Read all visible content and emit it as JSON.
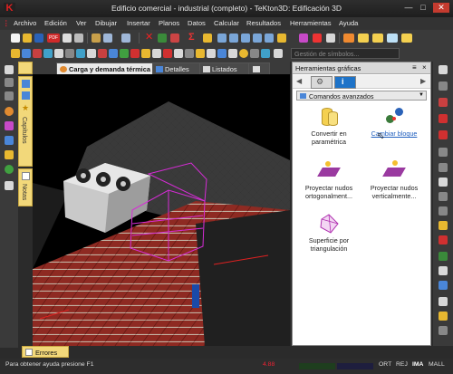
{
  "window": {
    "title": "Edificio comercial - industrial (completo) - TeKton3D: Edificación 3D",
    "app_icon_letter": "K"
  },
  "menu": [
    "Archivo",
    "Edición",
    "Ver",
    "Dibujar",
    "Insertar",
    "Planos",
    "Datos",
    "Calcular",
    "Resultados",
    "Herramientas",
    "Ayuda"
  ],
  "symbol_search": {
    "placeholder": "Gestión de símbolos..."
  },
  "left_tabs": {
    "chapters": "Capítulos",
    "notes": "Notas"
  },
  "view_tabs": [
    "Carga y demanda térmica",
    "Detalles",
    "Listados"
  ],
  "panel": {
    "title": "Herramientas gráficas",
    "combo": "Comandos avanzados",
    "commands": [
      {
        "label": "Convertir en paramétrica",
        "icon": "convert-parametric-icon"
      },
      {
        "label": "Cambiar bloque",
        "icon": "change-block-icon"
      },
      {
        "label": "Proyectar nudos ortogonalment...",
        "icon": "project-nodes-orthogonal-icon"
      },
      {
        "label": "Proyectar nudos verticalmente...",
        "icon": "project-nodes-vertical-icon"
      },
      {
        "label": "Superficie por triangulación",
        "icon": "triangulation-surface-icon"
      }
    ]
  },
  "errors_tab": "Errores",
  "status": {
    "help": "Para obtener ayuda presione F1",
    "indicators": [
      "ORT",
      "REJ",
      "IMA",
      "MALL"
    ],
    "coord_x": "4.88"
  },
  "colors": {
    "accent": "#1e73c8",
    "tab_yellow": "#f2d87a",
    "brick": "#8e2a22",
    "magenta": "#d62cd6"
  }
}
